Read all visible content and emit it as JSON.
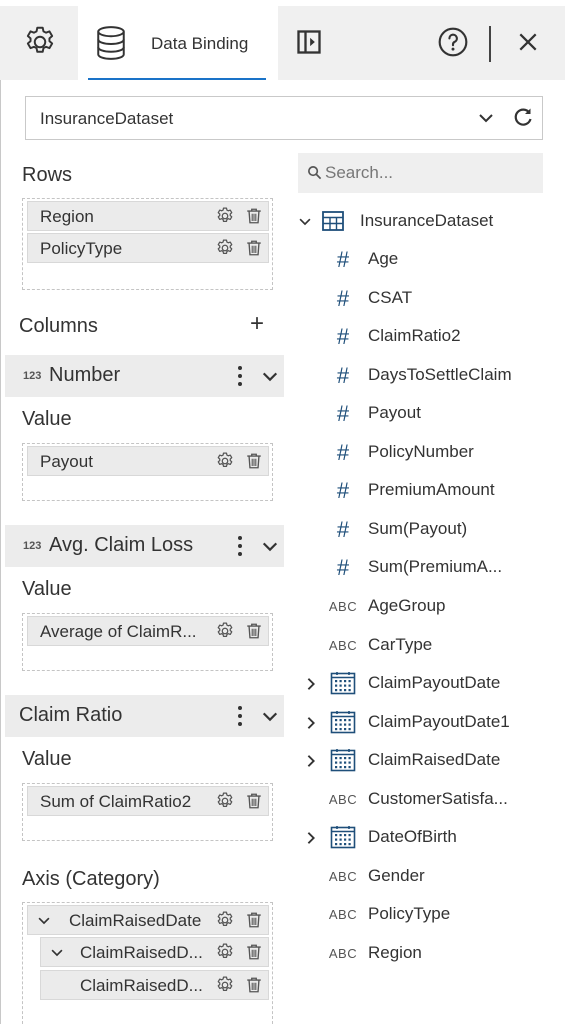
{
  "header": {
    "tab_label": "Data Binding"
  },
  "dataset": {
    "selected": "InsuranceDataset"
  },
  "rows": {
    "title": "Rows",
    "items": [
      "Region",
      "PolicyType"
    ]
  },
  "columns": {
    "title": "Columns",
    "add_symbol": "+"
  },
  "groups": [
    {
      "badge": "123",
      "title": "Number",
      "value_label": "Value",
      "item": "Payout"
    },
    {
      "badge": "123",
      "title": "Avg. Claim Loss",
      "value_label": "Value",
      "item": "Average of ClaimR..."
    },
    {
      "badge": "",
      "title": "Claim Ratio",
      "value_label": "Value",
      "item": "Sum of ClaimRatio2"
    }
  ],
  "axis": {
    "title": "Axis (Category)",
    "items": [
      "ClaimRaisedDate",
      "ClaimRaisedD...",
      "ClaimRaisedD..."
    ]
  },
  "search": {
    "placeholder": "Search..."
  },
  "tree": {
    "root": "InsuranceDataset",
    "fields": [
      {
        "type": "#",
        "name": "Age"
      },
      {
        "type": "#",
        "name": "CSAT"
      },
      {
        "type": "#",
        "name": "ClaimRatio2"
      },
      {
        "type": "#",
        "name": "DaysToSettleClaim"
      },
      {
        "type": "#",
        "name": "Payout"
      },
      {
        "type": "#",
        "name": "PolicyNumber"
      },
      {
        "type": "#",
        "name": "PremiumAmount"
      },
      {
        "type": "#",
        "name": "Sum(Payout)"
      },
      {
        "type": "#",
        "name": "Sum(PremiumA..."
      },
      {
        "type": "ABC",
        "name": "AgeGroup"
      },
      {
        "type": "ABC",
        "name": "CarType"
      },
      {
        "type": "date",
        "name": "ClaimPayoutDate"
      },
      {
        "type": "date",
        "name": "ClaimPayoutDate1"
      },
      {
        "type": "date",
        "name": "ClaimRaisedDate"
      },
      {
        "type": "ABC",
        "name": "CustomerSatisfa..."
      },
      {
        "type": "date",
        "name": "DateOfBirth"
      },
      {
        "type": "ABC",
        "name": "Gender"
      },
      {
        "type": "ABC",
        "name": "PolicyType"
      },
      {
        "type": "ABC",
        "name": "Region"
      }
    ]
  },
  "colors": {
    "accent": "#1a73c8",
    "icon_blue": "#1f4f7a"
  }
}
